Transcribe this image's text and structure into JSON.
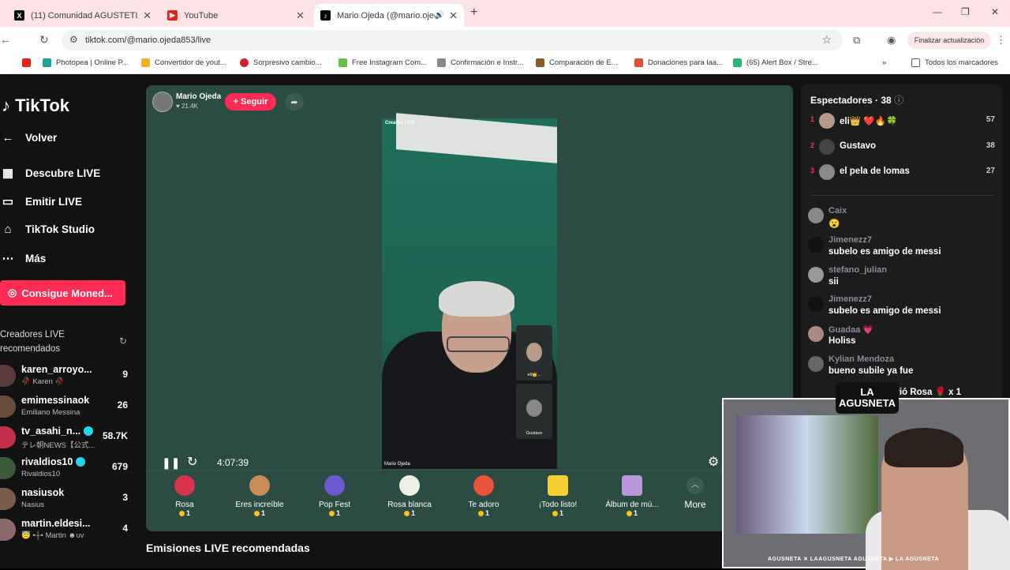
{
  "browser": {
    "tabs": [
      {
        "title": "(11) Comunidad AGUSTETISMO",
        "icon": "x-logo-icon"
      },
      {
        "title": "YouTube",
        "icon": "youtube-icon"
      },
      {
        "title": "Mario Ojeda (@mario.ojeda",
        "icon": "tiktok-icon"
      }
    ],
    "url": "tiktok.com/@mario.ojeda853/live",
    "update_label": "Finalizar actualización",
    "bookmarks": [
      "Photopea | Online P...",
      "Convertidor de yout...",
      "Sorpresivo cambio...",
      "Free Instagram Com...",
      "Confirmación e Instr...",
      "Comparación de E...",
      "Donaciones para laa...",
      "(65) Alert Box / Stre..."
    ],
    "all_bookmarks": "Todos los marcadores"
  },
  "sidebar": {
    "logo": "TikTok",
    "back": "Volver",
    "nav": [
      "Descubre LIVE",
      "Emitir LIVE",
      "TikTok Studio",
      "Más"
    ],
    "coins_button": "Consigue Moned...",
    "recommended_heading": "Creadores LIVE recomendados",
    "creators": [
      {
        "name": "karen_arroyo...",
        "sub": "🥀 Karen 🥀",
        "count": "9",
        "verified": false
      },
      {
        "name": "emimessinaok",
        "sub": "Emiliano Messina",
        "count": "26",
        "verified": false
      },
      {
        "name": "tv_asahi_n...",
        "sub": "テレ朝NEWS【公式...",
        "count": "58.7K",
        "verified": true
      },
      {
        "name": "rivaldios10",
        "sub": "Rivaldios10",
        "count": "679",
        "verified": true
      },
      {
        "name": "nasiusok",
        "sub": "Nasius",
        "count": "3",
        "verified": false
      },
      {
        "name": "martin.eldesi...",
        "sub": "😇 •┼• Martin ☻uv",
        "count": "4",
        "verified": false
      }
    ]
  },
  "stream": {
    "host_name": "Mario Ojeda",
    "host_likes": "♥ 21.4K",
    "follow": "+ Seguir",
    "video_tag": "Creador LIVE",
    "watermark": "Mario Ojeda",
    "guests": [
      "eli👑...",
      "Gustavo"
    ],
    "time": "4:07:39",
    "gifts": [
      {
        "label": "Rosa",
        "price": "1",
        "color": "#d8334a"
      },
      {
        "label": "Eres increíble",
        "price": "1",
        "color": "#c98c54"
      },
      {
        "label": "Pop Fest",
        "price": "1",
        "color": "#6a5acd"
      },
      {
        "label": "Rosa blanca",
        "price": "1",
        "color": "#f0efe6"
      },
      {
        "label": "Te adoro",
        "price": "1",
        "color": "#e8533a"
      },
      {
        "label": "¡Todo listo!",
        "price": "1",
        "color": "#f5d033"
      },
      {
        "label": "Álbum de mú...",
        "price": "1",
        "color": "#b896d8"
      }
    ],
    "more": "More",
    "recommended_title": "Emisiones LIVE recomendadas"
  },
  "chat": {
    "viewers_label": "Espectadores · 38",
    "ranking": [
      {
        "rank": "1",
        "name": "eli👑 ❤️🔥🍀",
        "score": "57"
      },
      {
        "rank": "2",
        "name": "Gustavo",
        "score": "38"
      },
      {
        "rank": "3",
        "name": "el pela de lomas",
        "score": "27"
      }
    ],
    "messages": [
      {
        "user": "Caix",
        "text": "😮"
      },
      {
        "user": "Jimenezz7",
        "text": "subelo es amigo de messi"
      },
      {
        "user": "stefano_julian",
        "text": "sii"
      },
      {
        "user": "Jimenezz7",
        "text": "subelo es amigo de messi"
      },
      {
        "user": "Guadaa 💗",
        "text": "Holiss"
      },
      {
        "user": "Kylian Mendoza",
        "text": "bueno subile ya fue"
      }
    ],
    "gift_event": "envió Rosa 🌹 x 1"
  },
  "overlay": {
    "badge": "LA AGUSNETA",
    "socials": "AGUSNETA  ✕ LAAGUSNETA  AGUSNETA  ▶ LA AGUSNETA"
  }
}
